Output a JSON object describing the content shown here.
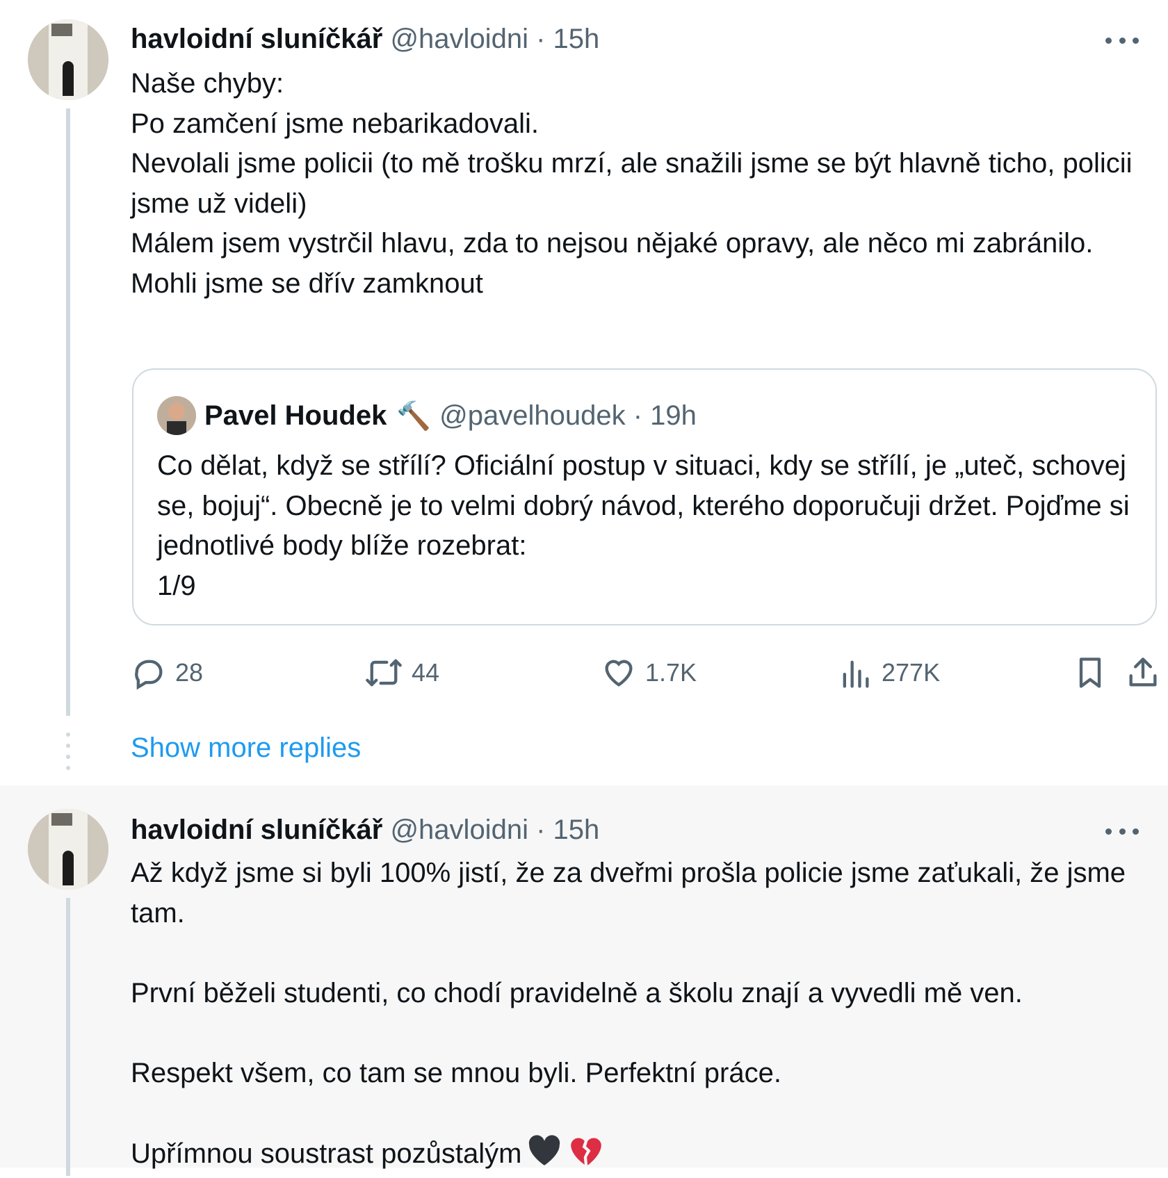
{
  "tweets": [
    {
      "display_name": "havloidní sluníčkář",
      "handle_time": "@havloidni · 15h",
      "text": "Naše chyby:\nPo zamčení jsme nebarikadovali.\nNevolali jsme policii (to mě trošku mrzí, ale snažili jsme se být hlavně ticho, policii jsme už videli)\nMálem jsem vystrčil hlavu, zda to nejsou nějaké opravy, ale něco mi zabránilo.\nMohli jsme se dřív zamknout",
      "quote": {
        "display_name": "Pavel Houdek",
        "hammer": "🔨",
        "handle_time": "@pavelhoudek · 19h",
        "text": "Co dělat, když se střílí? Oficiální postup v situaci, kdy se střílí, je „uteč, schovej se, bojuj“. Obecně je to velmi dobrý návod, kterého doporučuji držet. Pojďme si jednotlivé body blíže rozebrat:\n1/9"
      },
      "actions": {
        "replies": "28",
        "retweets": "44",
        "likes": "1.7K",
        "views": "277K"
      }
    },
    {
      "display_name": "havloidní sluníčkář",
      "handle_time": "@havloidni · 15h",
      "text": "Až když jsme si byli 100% jistí, že za dveřmi prošla policie jsme zaťukali, že jsme tam.\n\nPrvní běželi studenti, co chodí pravidelně a školu znají a vyvedli mě ven.\n\nRespekt všem, co tam se mnou byli. Perfektní práce.\n\nUpřímnou soustrast pozůstalým"
    }
  ],
  "show_more_replies": "Show more replies",
  "icons": {
    "more": "more-dots-icon",
    "reply": "reply-bubble-icon",
    "retweet": "retweet-icon",
    "like": "heart-icon",
    "views": "views-chart-icon",
    "bookmark": "bookmark-icon",
    "share": "share-icon",
    "black_heart": "black-heart-emoji",
    "broken_heart": "broken-heart-emoji"
  },
  "colors": {
    "text": "#0f1419",
    "secondary": "#536471",
    "link": "#1d9bf0",
    "border": "#cfd9de",
    "focused_bg": "#f7f7f7"
  }
}
